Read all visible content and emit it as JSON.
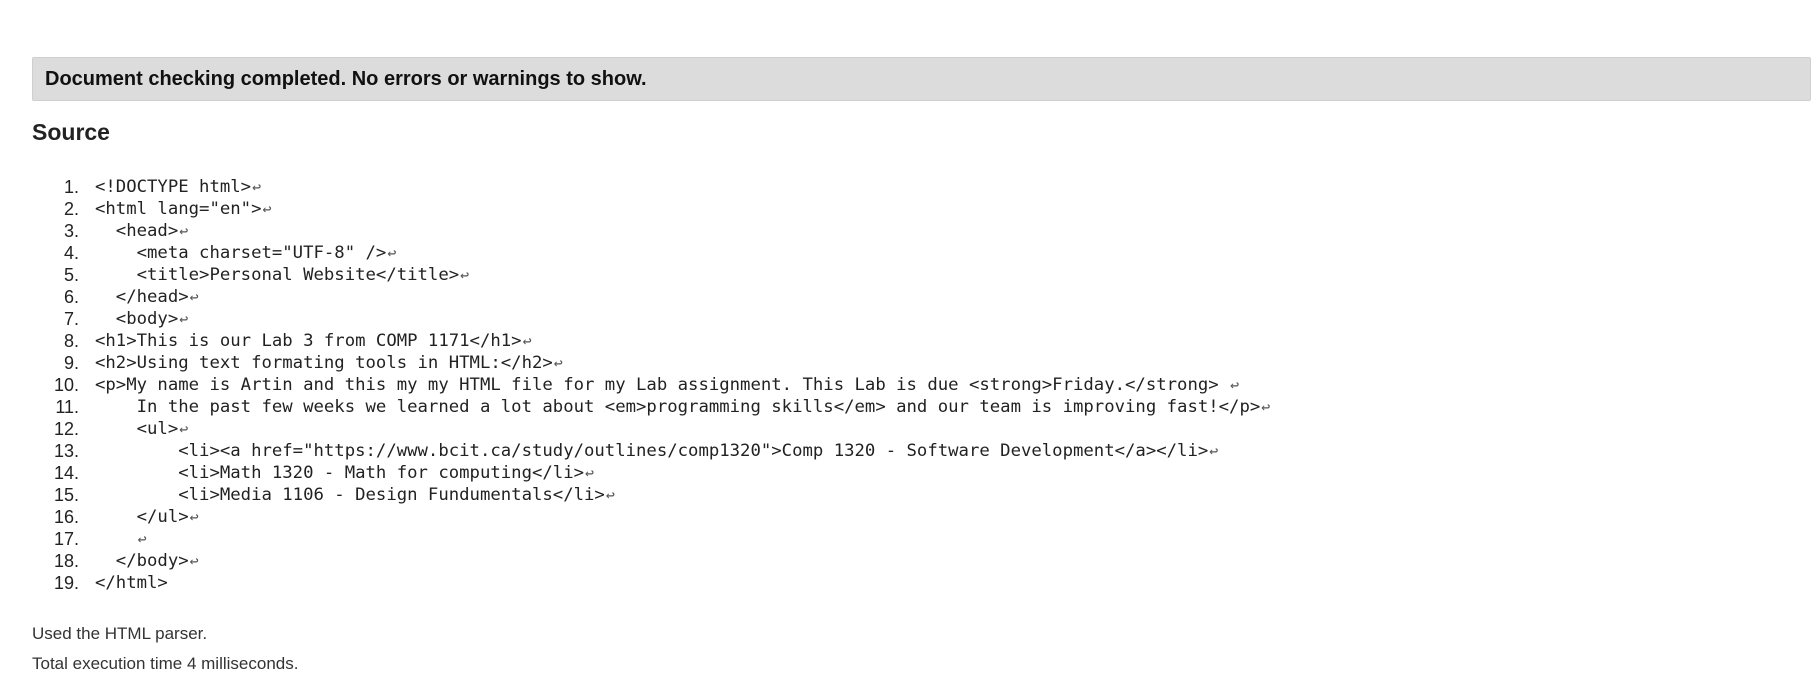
{
  "result": {
    "message": "Document checking completed. No errors or warnings to show."
  },
  "source": {
    "heading": "Source",
    "return_glyph": "↩",
    "lines": [
      {
        "num": "1.",
        "code": "<!DOCTYPE html>",
        "eol": true
      },
      {
        "num": "2.",
        "code": "<html lang=\"en\">",
        "eol": true
      },
      {
        "num": "3.",
        "code": "  <head>",
        "eol": true
      },
      {
        "num": "4.",
        "code": "    <meta charset=\"UTF-8\" />",
        "eol": true
      },
      {
        "num": "5.",
        "code": "    <title>Personal Website</title>",
        "eol": true
      },
      {
        "num": "6.",
        "code": "  </head>",
        "eol": true
      },
      {
        "num": "7.",
        "code": "  <body>",
        "eol": true
      },
      {
        "num": "8.",
        "code": "<h1>This is our Lab 3 from COMP 1171</h1>",
        "eol": true
      },
      {
        "num": "9.",
        "code": "<h2>Using text formating tools in HTML:</h2>",
        "eol": true
      },
      {
        "num": "10.",
        "code": "<p>My name is Artin and this my my HTML file for my Lab assignment. This Lab is due <strong>Friday.</strong> ",
        "eol": true
      },
      {
        "num": "11.",
        "code": "    In the past few weeks we learned a lot about <em>programming skills</em> and our team is improving fast!</p>",
        "eol": true
      },
      {
        "num": "12.",
        "code": "    <ul>",
        "eol": true
      },
      {
        "num": "13.",
        "code": "        <li><a href=\"https://www.bcit.ca/study/outlines/comp1320\">Comp 1320 - Software Development</a></li>",
        "eol": true
      },
      {
        "num": "14.",
        "code": "        <li>Math 1320 - Math for computing</li>",
        "eol": true
      },
      {
        "num": "15.",
        "code": "        <li>Media 1106 - Design Fundumentals</li>",
        "eol": true
      },
      {
        "num": "16.",
        "code": "    </ul>",
        "eol": true
      },
      {
        "num": "17.",
        "code": "    ",
        "eol": true
      },
      {
        "num": "18.",
        "code": "  </body>",
        "eol": true
      },
      {
        "num": "19.",
        "code": "</html>",
        "eol": false
      }
    ]
  },
  "footer": {
    "parser_note": "Used the HTML parser.",
    "time_note": "Total execution time 4 milliseconds."
  }
}
